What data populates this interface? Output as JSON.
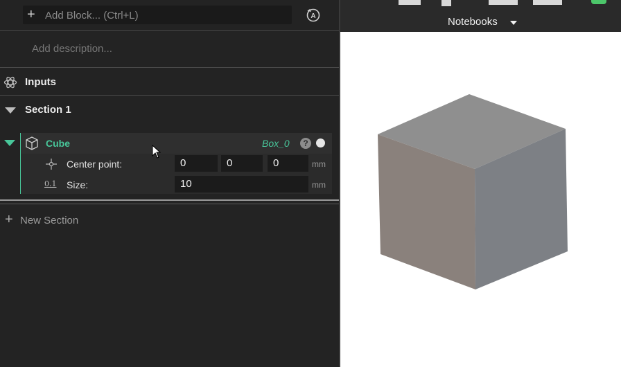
{
  "editor": {
    "add_block_placeholder": "Add Block... (Ctrl+L)",
    "description_placeholder": "Add description...",
    "inputs_label": "Inputs",
    "section_label": "Section 1",
    "new_section_label": "New Section"
  },
  "block": {
    "title": "Cube",
    "variable": "Box_0",
    "help_glyph": "?",
    "params": [
      {
        "label": "Center point:",
        "values": [
          "0",
          "0",
          "0"
        ],
        "unit": "mm",
        "icon": "center-point-icon"
      },
      {
        "label": "Size:",
        "values": [
          "10"
        ],
        "unit": "mm",
        "icon_text": "0.1"
      }
    ]
  },
  "viewer": {
    "notebooks_label": "Notebooks"
  },
  "colors": {
    "accent": "#48c79a",
    "cube_top": "#8f8f8f",
    "cube_left": "#8a817c",
    "cube_right": "#7d8085"
  }
}
